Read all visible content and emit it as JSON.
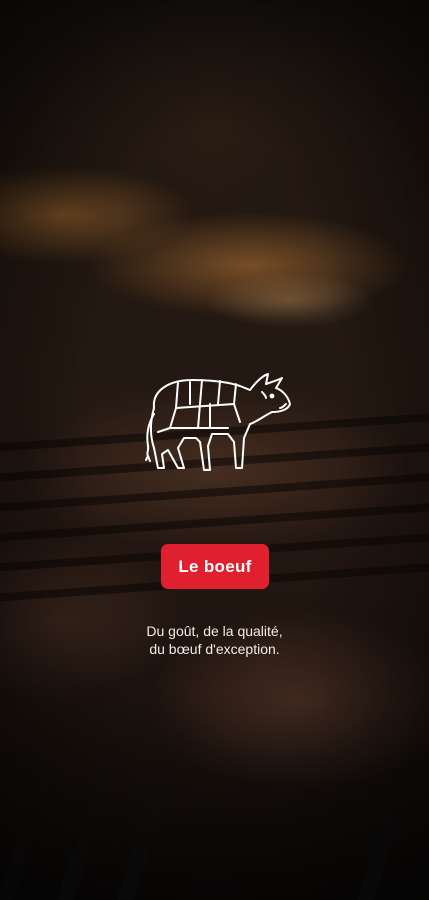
{
  "brand": {
    "logo_icon": "cow-butcher-cuts-icon",
    "accent_color": "#e0202e"
  },
  "cta": {
    "label": "Le boeuf"
  },
  "tagline": {
    "line1": "Du goût, de la qualité,",
    "line2": "du bœuf d'exception."
  },
  "background": {
    "image_subject": "grilled steak"
  }
}
